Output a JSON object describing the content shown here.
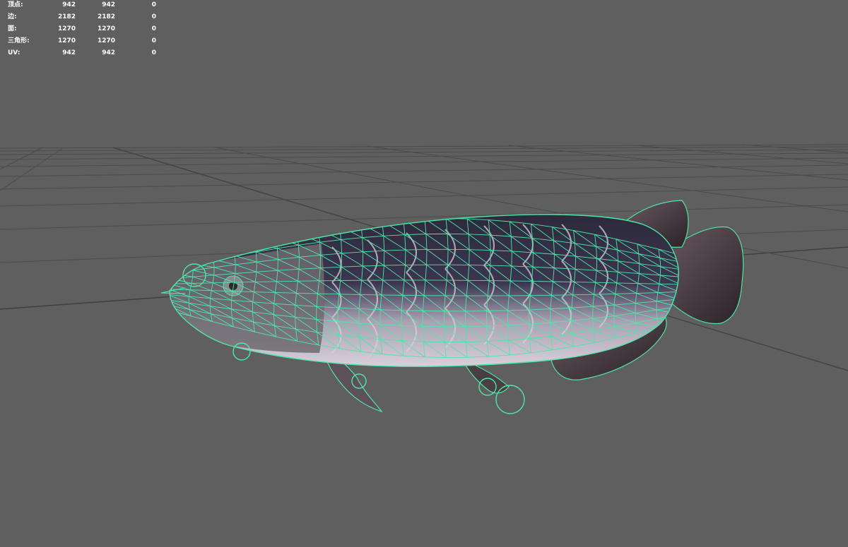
{
  "hud": {
    "rows": [
      {
        "label": "顶点:",
        "v1": "942",
        "v2": "942",
        "v3": "0"
      },
      {
        "label": "边:",
        "v1": "2182",
        "v2": "2182",
        "v3": "0"
      },
      {
        "label": "面:",
        "v1": "1270",
        "v2": "1270",
        "v3": "0"
      },
      {
        "label": "三角形:",
        "v1": "1270",
        "v2": "1270",
        "v3": "0"
      },
      {
        "label": "UV:",
        "v1": "942",
        "v2": "942",
        "v3": "0"
      }
    ]
  },
  "colors": {
    "background": "#5f5f5f",
    "grid": "#4a4a4a",
    "wireframe": "#4ee6a8",
    "hud_text": "#ffffff"
  },
  "scene": {
    "object": "arowana-fish-model",
    "display_mode": "wireframe-on-shaded"
  }
}
